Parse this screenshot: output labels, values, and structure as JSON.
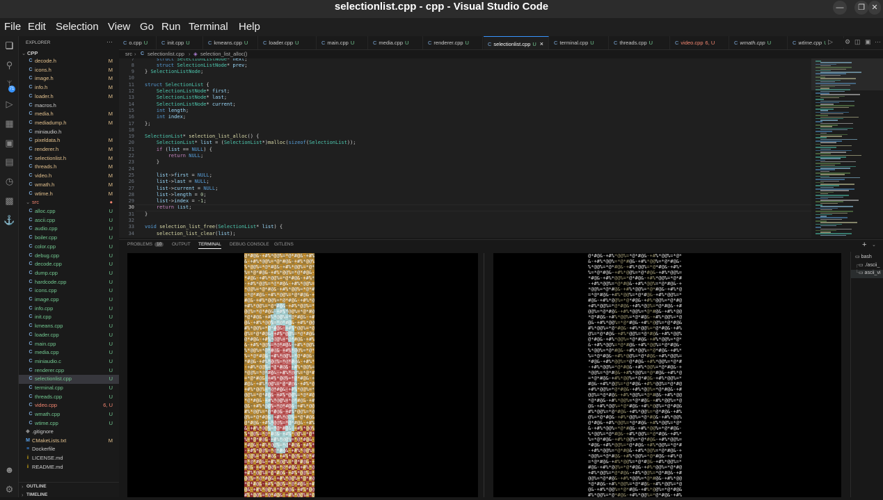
{
  "window": {
    "title": "selectionlist.cpp - cpp - Visual Studio Code",
    "minimize_icon": "minimize-icon",
    "restore_icon": "restore-icon",
    "close_icon": "close-icon"
  },
  "menu": [
    "File",
    "Edit",
    "Selection",
    "View",
    "Go",
    "Run",
    "Terminal",
    "Help"
  ],
  "activity_bar": {
    "scm_badge": "71",
    "icons": [
      "files-icon",
      "search-icon",
      "source-control-icon",
      "run-debug-icon",
      "extensions-icon",
      "remote-explorer-icon",
      "testing-icon",
      "timeline-icon",
      "docker-icon",
      "account-icon",
      "settings-gear-icon"
    ]
  },
  "explorer": {
    "header": "EXPLORER",
    "more": "···",
    "root": "CPP",
    "files_top": [
      {
        "name": "decode.h",
        "status": "M"
      },
      {
        "name": "icons.h",
        "status": "M"
      },
      {
        "name": "image.h",
        "status": "M"
      },
      {
        "name": "info.h",
        "status": "M"
      },
      {
        "name": "loader.h",
        "status": "M"
      },
      {
        "name": "macros.h",
        "status": ""
      },
      {
        "name": "media.h",
        "status": "M"
      },
      {
        "name": "mediadump.h",
        "status": "M"
      },
      {
        "name": "miniaudio.h",
        "status": ""
      },
      {
        "name": "pixeldata.h",
        "status": "M"
      },
      {
        "name": "renderer.h",
        "status": "M"
      },
      {
        "name": "selectionlist.h",
        "status": "M"
      },
      {
        "name": "threads.h",
        "status": "M"
      },
      {
        "name": "video.h",
        "status": "M"
      },
      {
        "name": "wmath.h",
        "status": "M"
      },
      {
        "name": "wtime.h",
        "status": "M"
      }
    ],
    "src_folder": "src",
    "src_files": [
      {
        "name": "alloc.cpp",
        "status": "U"
      },
      {
        "name": "ascii.cpp",
        "status": "U"
      },
      {
        "name": "audio.cpp",
        "status": "U"
      },
      {
        "name": "boiler.cpp",
        "status": "U"
      },
      {
        "name": "color.cpp",
        "status": "U"
      },
      {
        "name": "debug.cpp",
        "status": "U"
      },
      {
        "name": "decode.cpp",
        "status": "U"
      },
      {
        "name": "dump.cpp",
        "status": "U"
      },
      {
        "name": "hardcode.cpp",
        "status": "U"
      },
      {
        "name": "icons.cpp",
        "status": "U"
      },
      {
        "name": "image.cpp",
        "status": "U"
      },
      {
        "name": "info.cpp",
        "status": "U"
      },
      {
        "name": "init.cpp",
        "status": "U"
      },
      {
        "name": "kmeans.cpp",
        "status": "U"
      },
      {
        "name": "loader.cpp",
        "status": "U"
      },
      {
        "name": "main.cpp",
        "status": "U"
      },
      {
        "name": "media.cpp",
        "status": "U"
      },
      {
        "name": "miniaudio.c",
        "status": "U"
      },
      {
        "name": "renderer.cpp",
        "status": "U"
      },
      {
        "name": "selectionlist.cpp",
        "status": "U"
      },
      {
        "name": "terminal.cpp",
        "status": "U"
      },
      {
        "name": "threads.cpp",
        "status": "U"
      },
      {
        "name": "video.cpp",
        "status": "6, U"
      },
      {
        "name": "wmath.cpp",
        "status": "U"
      },
      {
        "name": "wtime.cpp",
        "status": "U"
      }
    ],
    "root_files": [
      {
        "name": ".gitignore",
        "status": ""
      },
      {
        "name": "CMakeLists.txt",
        "status": "M"
      },
      {
        "name": "Dockerfile",
        "status": ""
      },
      {
        "name": "LICENSE.md",
        "status": ""
      },
      {
        "name": "README.md",
        "status": ""
      }
    ],
    "outline": "OUTLINE",
    "timeline": "TIMELINE"
  },
  "tabs": [
    {
      "name": "o.cpp",
      "status": "U"
    },
    {
      "name": "init.cpp",
      "status": "U"
    },
    {
      "name": "kmeans.cpp",
      "status": "U"
    },
    {
      "name": "loader.cpp",
      "status": "U"
    },
    {
      "name": "main.cpp",
      "status": "U"
    },
    {
      "name": "media.cpp",
      "status": "U"
    },
    {
      "name": "renderer.cpp",
      "status": "U"
    },
    {
      "name": "selectionlist.cpp",
      "status": "U"
    },
    {
      "name": "terminal.cpp",
      "status": "U"
    },
    {
      "name": "threads.cpp",
      "status": "U"
    },
    {
      "name": "video.cpp",
      "status": "6, U"
    },
    {
      "name": "wmath.cpp",
      "status": "U"
    },
    {
      "name": "wtime.cpp",
      "status": "U"
    }
  ],
  "active_tab_close": "×",
  "breadcrumb": {
    "folder": "src",
    "file": "selectionlist.cpp",
    "symbol": "selection_list_alloc()"
  },
  "code_lines": [
    {
      "n": "7",
      "t": "    struct SelectionListNode* next;"
    },
    {
      "n": "8",
      "t": "    struct SelectionListNode* prev;"
    },
    {
      "n": "9",
      "t": "} SelectionListNode;"
    },
    {
      "n": "10",
      "t": ""
    },
    {
      "n": "11",
      "t": "struct SelectionList {"
    },
    {
      "n": "12",
      "t": "    SelectionListNode* first;"
    },
    {
      "n": "13",
      "t": "    SelectionListNode* last;"
    },
    {
      "n": "14",
      "t": "    SelectionListNode* current;"
    },
    {
      "n": "15",
      "t": "    int length;"
    },
    {
      "n": "16",
      "t": "    int index;"
    },
    {
      "n": "17",
      "t": "};"
    },
    {
      "n": "18",
      "t": ""
    },
    {
      "n": "19",
      "t": "SelectionList* selection_list_alloc() {"
    },
    {
      "n": "20",
      "t": "    SelectionList* list = (SelectionList*)malloc(sizeof(SelectionList));"
    },
    {
      "n": "21",
      "t": "    if (list == NULL) {"
    },
    {
      "n": "22",
      "t": "        return NULL;"
    },
    {
      "n": "23",
      "t": "    }"
    },
    {
      "n": "24",
      "t": ""
    },
    {
      "n": "25",
      "t": "    list->first = NULL;"
    },
    {
      "n": "26",
      "t": "    list->last = NULL;"
    },
    {
      "n": "27",
      "t": "    list->current = NULL;"
    },
    {
      "n": "28",
      "t": "    list->length = 0;"
    },
    {
      "n": "29",
      "t": "    list->index = -1;"
    },
    {
      "n": "30",
      "t": "    return list;"
    },
    {
      "n": "31",
      "t": "}"
    },
    {
      "n": "32",
      "t": ""
    },
    {
      "n": "33",
      "t": "void selection_list_free(SelectionList* list) {"
    },
    {
      "n": "34",
      "t": "    selection_list_clear(list);"
    }
  ],
  "panel": {
    "tabs": [
      "PROBLEMS",
      "OUTPUT",
      "TERMINAL",
      "DEBUG CONSOLE",
      "GITLENS"
    ],
    "problems_count": "10",
    "active": "TERMINAL",
    "add_terminal": "+",
    "terminals": [
      "bash",
      "./ascii_",
      "ascii_vi"
    ]
  },
  "colors": {
    "accent": "#3794ff",
    "untracked": "#73c991",
    "modified": "#e2c08d",
    "error": "#f48771"
  }
}
